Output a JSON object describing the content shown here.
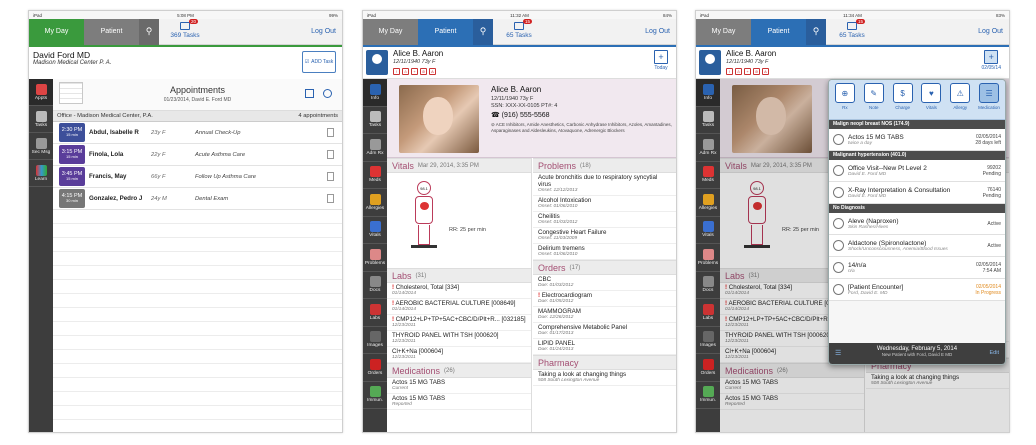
{
  "status": {
    "left": "iPad",
    "time1": "5:08 PM",
    "time2": "11:32 AM",
    "time3": "11:34 AM",
    "batt1": "99%",
    "batt2": "84%",
    "batt3": "83%"
  },
  "tabs": {
    "myday": "My Day",
    "patient": "Patient",
    "logout": "Log Out"
  },
  "tasks": {
    "s1_count": "369 Tasks",
    "s1_badge": "20",
    "s2_count": "65 Tasks",
    "s2_badge": "15",
    "s3_count": "65 Tasks",
    "s3_badge": "15"
  },
  "screen1": {
    "user_name": "David Ford MD",
    "user_org": "Madison Medical Center P. A.",
    "add_task": "ADD Task",
    "appt_title": "Appointments",
    "appt_date": "01/23/2014, David E. Ford MD",
    "office": "Office - Madison Medical Center, P.A.",
    "appt_count": "4 appointments",
    "sidebar": [
      "Appts",
      "Tasks",
      "Sec Msg",
      "Learn"
    ],
    "appointments": [
      {
        "time": "2:30 PM",
        "dur": "15 min",
        "name": "Abdul, Isabelle R",
        "age": "23y F",
        "reason": "Annual Check-Up",
        "color": "#3d4f9a"
      },
      {
        "time": "3:15 PM",
        "dur": "15 min",
        "name": "Finola, Lola",
        "age": "22y F",
        "reason": "Acute Asthma Care",
        "color": "#5a3d9a"
      },
      {
        "time": "3:45 PM",
        "dur": "15 min",
        "name": "Francis, May",
        "age": "66y F",
        "reason": "Follow Up Asthma Care",
        "color": "#5a3d9a"
      },
      {
        "time": "4:15 PM",
        "dur": "30 min",
        "name": "Gonzalez, Pedro J",
        "age": "24y M",
        "reason": "Dental Exam",
        "color": "#777777"
      }
    ]
  },
  "patient": {
    "name": "Alice B. Aaron",
    "dob": "12/11/1940  73y F",
    "age_sex": "73y    F",
    "ssn": "SSN: XXX-XX-0105      PT#: 4",
    "phone": "(916) 555-5568",
    "allergies": "ACE Inhibitors, Amide Anesthetics, Carbonic Anhydrase Inhibitors, Azoles, Amantadines, Asparaginases and Aldesleukins, Atovaquone, Adrenergic Blockers",
    "today": "Today",
    "today3": "02/05/14",
    "sidebar": [
      "Info",
      "Tasks",
      "Adm Rx",
      "Meds",
      "Allergies",
      "Vitals",
      "Problems",
      "Docs",
      "Labs",
      "Images",
      "Orders",
      "Immun."
    ],
    "vitals_title": "Vitals",
    "vitals_date": "Mar 29, 2014, 3:35 PM",
    "temp": "98.1",
    "rr": "RR:  25 per min",
    "labs_title": "Labs",
    "labs_count": "(31)",
    "labs": [
      {
        "name": "Cholesterol, Total [334]",
        "date": "01/14/2014",
        "flag": "!"
      },
      {
        "name": "AEROBIC BACTERIAL CULTURE [008649]",
        "date": "01/14/2014",
        "flag": "!"
      },
      {
        "name": "CMP12+LP+TP+5AC+CBC/D/Plt+R... [032185]",
        "date": "12/23/2011",
        "flag": "!"
      },
      {
        "name": "THYROID PANEL WITH TSH [000620]",
        "date": "12/23/2011",
        "flag": ""
      },
      {
        "name": "Cl+K+Na [000604]",
        "date": "12/23/2011",
        "flag": ""
      }
    ],
    "meds_title": "Medications",
    "meds_count": "(26)",
    "meds": [
      {
        "name": "Actos 15 MG TABS",
        "status": "Current"
      },
      {
        "name": "Actos 15 MG TABS",
        "status": "Reported"
      }
    ],
    "problems_title": "Problems",
    "problems_count": "(18)",
    "problems": [
      {
        "name": "Acute bronchitis due to respiratory syncytial virus",
        "onset": "Onset: 12/12/2013"
      },
      {
        "name": "Alcohol Intoxication",
        "onset": "Onset: 01/06/2010"
      },
      {
        "name": "Cheilitis",
        "onset": "Onset: 01/03/2012"
      },
      {
        "name": "Congestive Heart Failure",
        "onset": "Onset: 11/03/2009"
      },
      {
        "name": "Delirium tremens",
        "onset": "Onset: 01/06/2010"
      }
    ],
    "orders_title": "Orders",
    "orders_count": "(17)",
    "orders": [
      {
        "name": "CBC",
        "due": "Due: 01/03/2012",
        "flag": ""
      },
      {
        "name": "Electrocardiogram",
        "due": "Due: 01/05/2012",
        "flag": "!"
      },
      {
        "name": "MAMMOGRAM",
        "due": "Due: 12/26/2012",
        "flag": ""
      },
      {
        "name": "Comprehensive Metabolic Panel",
        "due": "Due: 01/17/2013",
        "flag": ""
      },
      {
        "name": "LIPID PANEL",
        "due": "Due: 01/24/2013",
        "flag": ""
      }
    ],
    "pharmacy_title": "Pharmacy",
    "pharmacy_name": "Taking a look at changing things",
    "pharmacy_addr": "508 South Lexington Avenue"
  },
  "screen3": {
    "actions": [
      "Rx",
      "Note",
      "Charge",
      "Vitals",
      "Allergy",
      "Medication"
    ],
    "groups": [
      {
        "header": "Malign neopl breast NOS (174.9)",
        "items": [
          {
            "title": "Actos 15 MG TABS",
            "sub": "twice a day",
            "r1": "02/05/2014",
            "r2": "28 days left",
            "orange": false
          }
        ]
      },
      {
        "header": "Malignant hypertension (401.0)",
        "items": [
          {
            "title": "Office Visit--New Pt Level 2",
            "sub": "David E. Ford MD",
            "r1": "99202",
            "r2": "Pending",
            "orange": false
          },
          {
            "title": "X-Ray Interpretation & Consultation",
            "sub": "David E. Ford MD",
            "r1": "76140",
            "r2": "Pending",
            "orange": false
          }
        ]
      },
      {
        "header": "No Diagnosis",
        "items": [
          {
            "title": "Aleve (Naproxen)",
            "sub": "Skin Rashes/Hives",
            "r1": "",
            "r2": "Active",
            "orange": false
          },
          {
            "title": "Aldactone (Spironolactone)",
            "sub": "Shock/Unconsciousness, Anemia/Blood Issues",
            "r1": "",
            "r2": "Active",
            "orange": false
          },
          {
            "title": "14/n/a",
            "sub": "n/a",
            "r1": "02/05/2014",
            "r2": "7:54 AM",
            "orange": false
          },
          {
            "title": "[Patient Encounter]",
            "sub": "Ford, David E. MD",
            "r1": "02/05/2014",
            "r2": "In Progress",
            "orange": true
          }
        ]
      }
    ],
    "footer_date": "Wednesday, February 5, 2014",
    "footer_sub": "New Patient with Ford, David E MD",
    "edit": "Edit"
  }
}
